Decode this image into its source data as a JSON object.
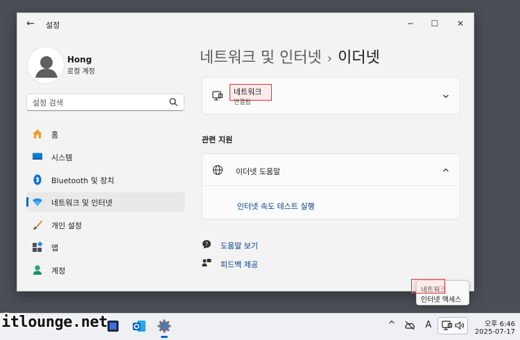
{
  "window": {
    "app_title": "설정",
    "back_icon": "back-arrow-icon",
    "controls": {
      "minimize": "─",
      "maximize": "☐",
      "close": "✕"
    }
  },
  "user": {
    "name": "Hong",
    "account_type": "로컬 계정"
  },
  "search": {
    "placeholder": "설정 검색"
  },
  "sidebar": {
    "items": [
      {
        "label": "홈",
        "icon": "home-icon"
      },
      {
        "label": "시스템",
        "icon": "system-icon"
      },
      {
        "label": "Bluetooth 및 장치",
        "icon": "bluetooth-icon"
      },
      {
        "label": "네트워크 및 인터넷",
        "icon": "network-icon",
        "active": true
      },
      {
        "label": "개인 설정",
        "icon": "brush-icon"
      },
      {
        "label": "앱",
        "icon": "apps-icon"
      },
      {
        "label": "계정",
        "icon": "account-icon"
      }
    ]
  },
  "main": {
    "breadcrumb_parent": "네트워크 및 인터넷",
    "breadcrumb_sep": "›",
    "breadcrumb_current": "이더넷",
    "network_card": {
      "title": "네트워크",
      "status": "연결됨"
    },
    "related_support_title": "관련 지원",
    "help_card": {
      "title": "이더넷 도움말",
      "link": "인터넷 속도 테스트 실행"
    },
    "footer_links": {
      "get_help": "도움말 보기",
      "feedback": "피드백 제공"
    }
  },
  "tooltip": {
    "title": "네트워크",
    "subtitle": "인터넷 액세스"
  },
  "brand": "itlounge.net",
  "taskbar": {
    "clock_time": "오후 6:46",
    "clock_date": "2025-07-17",
    "tray_chevron": "^",
    "ime": "A"
  },
  "colors": {
    "accent": "#0067c0",
    "link": "#003e92",
    "highlight": "#e0302a"
  }
}
